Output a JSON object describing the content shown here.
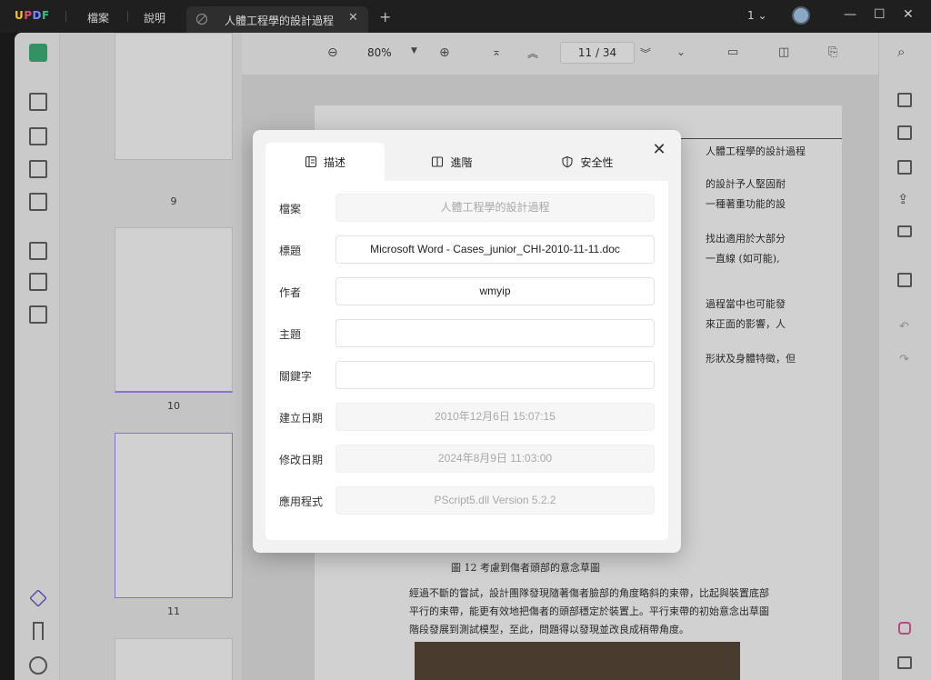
{
  "app": {
    "logo": "UPDF",
    "menu": [
      "檔案",
      "說明"
    ],
    "tab_title": "人體工程學的設計過程",
    "page_count": "1"
  },
  "toolbar": {
    "zoom": "80%",
    "current_page": "11",
    "page_sep": "/",
    "total_pages": "34"
  },
  "thumbnails": [
    {
      "label": "9"
    },
    {
      "label": "10"
    },
    {
      "label": "11"
    }
  ],
  "page_content": {
    "header": "人體工程學的設計過程",
    "lines": [
      "的設計予人堅固耐",
      "一種著重功能的設",
      "找出適用於大部分",
      "一直線 (如可能),",
      "過程當中也可能發",
      "來正面的影響，人",
      "形狀及身體特徵，但"
    ],
    "figure_caption": "圖 12 考慮到傷者頭部的意念草圖",
    "bullet_text": [
      "經過不斷的嘗試，設計團隊發現隨著傷者臉部的角度略斜的束帶，比起與裝置底部",
      "平行的束帶，能更有效地把傷者的頭部穩定於裝置上。平行束帶的初始意念出草圖",
      "階段發展到測試模型，至此，問題得以發現並改良成稍帶角度。"
    ]
  },
  "dialog": {
    "tabs": [
      "描述",
      "進階",
      "安全性"
    ],
    "rows": [
      {
        "label": "檔案",
        "value": "人體工程學的設計過程",
        "readonly": true
      },
      {
        "label": "標題",
        "value": "Microsoft Word - Cases_junior_CHI-2010-11-11.doc",
        "readonly": false
      },
      {
        "label": "作者",
        "value": "wmyip",
        "readonly": false
      },
      {
        "label": "主題",
        "value": "",
        "readonly": false
      },
      {
        "label": "關鍵字",
        "value": "",
        "readonly": false
      },
      {
        "label": "建立日期",
        "value": "2010年12月6日 15:07:15",
        "readonly": true
      },
      {
        "label": "修改日期",
        "value": "2024年8月9日 11:03:00",
        "readonly": true
      },
      {
        "label": "應用程式",
        "value": "PScript5.dll Version 5.2.2",
        "readonly": true
      }
    ]
  }
}
